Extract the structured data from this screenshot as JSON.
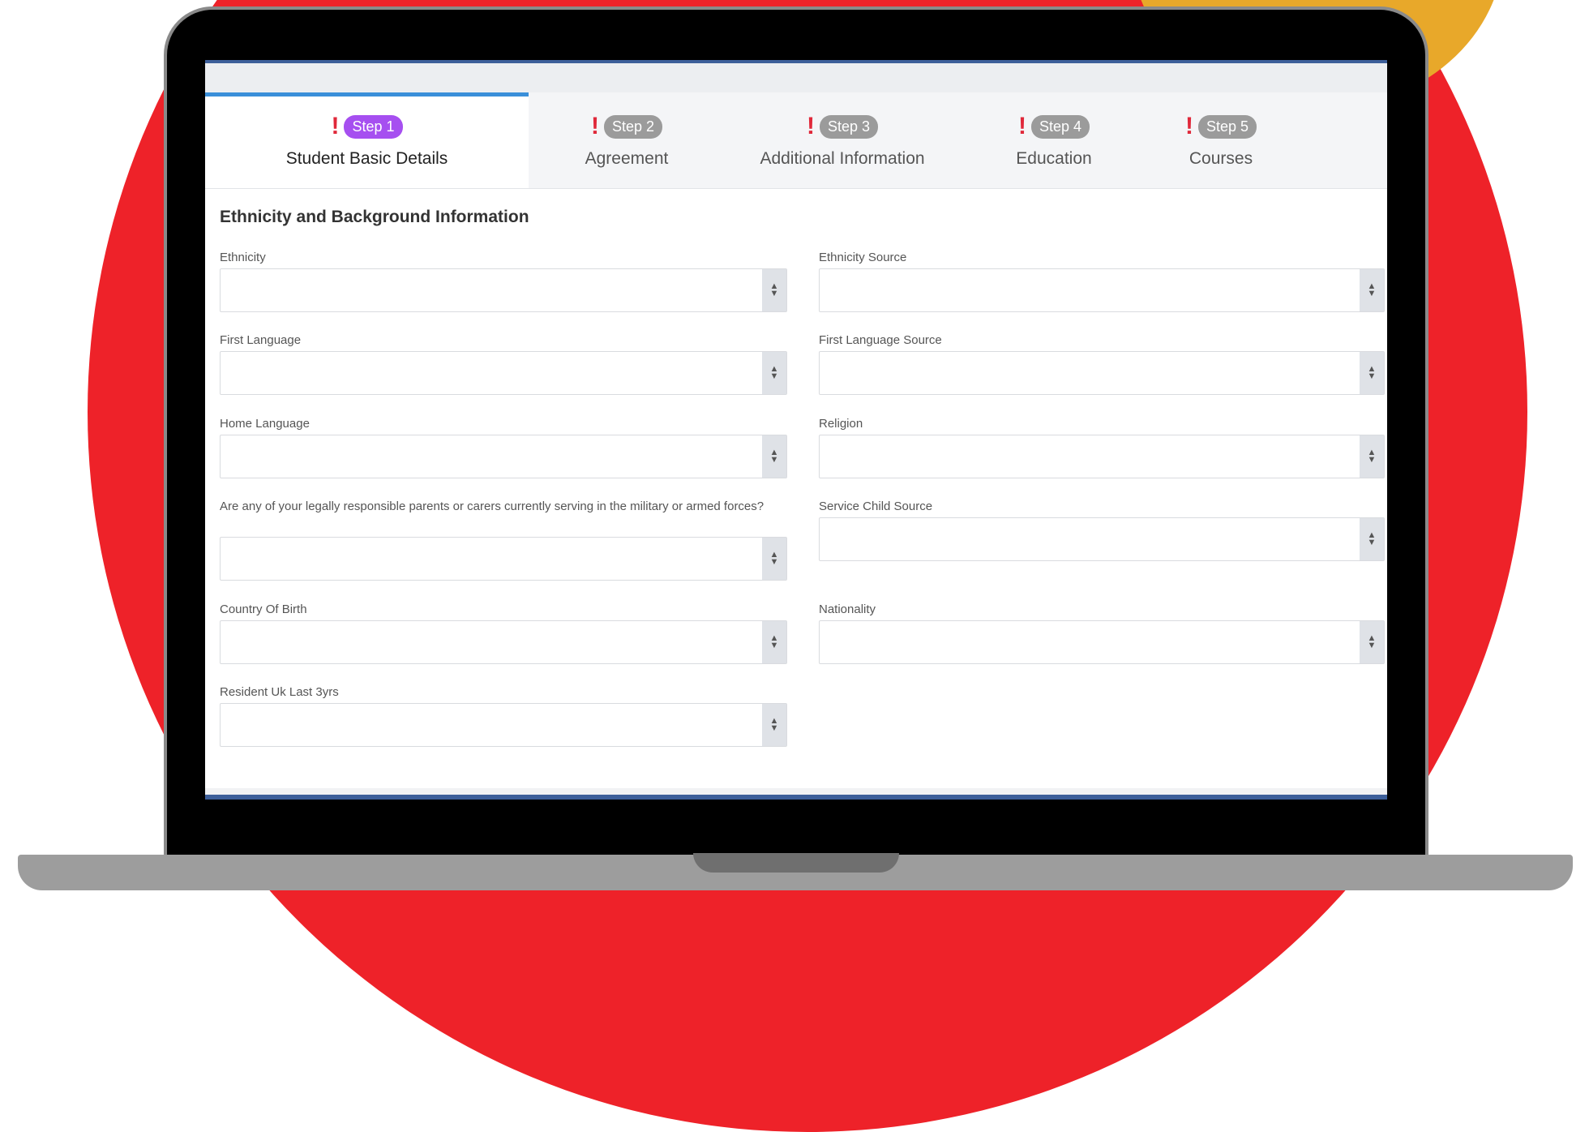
{
  "tabs": [
    {
      "step": "Step 1",
      "label": "Student Basic Details",
      "active": true
    },
    {
      "step": "Step 2",
      "label": "Agreement",
      "active": false
    },
    {
      "step": "Step 3",
      "label": "Additional Information",
      "active": false
    },
    {
      "step": "Step 4",
      "label": "Education",
      "active": false
    },
    {
      "step": "Step 5",
      "label": "Courses",
      "active": false
    }
  ],
  "warning_symbol": "!",
  "section": {
    "title": "Ethnicity and Background Information"
  },
  "fields": {
    "ethnicity": {
      "label": "Ethnicity",
      "value": ""
    },
    "ethnicity_source": {
      "label": "Ethnicity Source",
      "value": ""
    },
    "first_language": {
      "label": "First Language",
      "value": ""
    },
    "first_language_source": {
      "label": "First Language Source",
      "value": ""
    },
    "home_language": {
      "label": "Home Language",
      "value": ""
    },
    "religion": {
      "label": "Religion",
      "value": ""
    },
    "service_child": {
      "label": "Are any of your legally responsible parents or carers currently serving in the military or armed forces?",
      "value": ""
    },
    "service_child_source": {
      "label": "Service Child Source",
      "value": ""
    },
    "country_of_birth": {
      "label": "Country Of Birth",
      "value": ""
    },
    "nationality": {
      "label": "Nationality",
      "value": ""
    },
    "resident_uk": {
      "label": "Resident Uk Last 3yrs",
      "value": ""
    }
  },
  "colors": {
    "background_red": "#ee2229",
    "background_yellow": "#e8a82a",
    "active_tab_accent": "#3a8fd9",
    "active_step_pill": "#a64ff0",
    "warning": "#e0283a"
  }
}
